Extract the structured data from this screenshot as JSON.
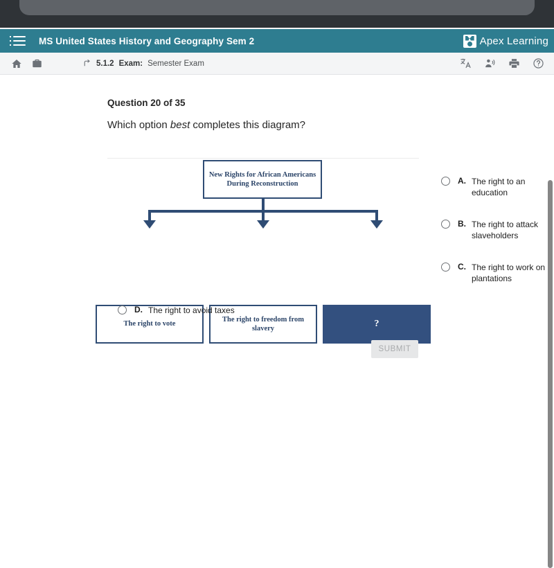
{
  "browser_chrome": {
    "glyph_left": "p",
    "glyph_right": "g"
  },
  "course_header": {
    "menu_icon": "hamburger-menu-icon",
    "title": "MS United States History and Geography Sem 2",
    "brand_name": "Apex Learning",
    "background_color": "#2e7d90"
  },
  "toolbar": {
    "home_icon": "home-icon",
    "briefcase_icon": "briefcase-icon",
    "up_level_icon": "up-level-arrow-icon",
    "breadcrumb_number": "5.1.2",
    "breadcrumb_kind": "Exam:",
    "breadcrumb_name": "Semester Exam",
    "translate_icon": "translate-icon",
    "read_aloud_icon": "read-aloud-icon",
    "print_icon": "print-icon",
    "help_icon": "help-icon"
  },
  "question": {
    "counter": "Question 20 of 35",
    "prompt_before": "Which option ",
    "prompt_emphasis": "best",
    "prompt_after": " completes this diagram?"
  },
  "diagram": {
    "top_box": "New Rights for African Americans During Reconstruction",
    "child_1": "The right to vote",
    "child_2": "The right to freedom from slavery",
    "child_3": "?",
    "line_color": "#2f4c74",
    "highlight_fill": "#33507f"
  },
  "options": [
    {
      "letter": "A.",
      "text": "The right to an education"
    },
    {
      "letter": "B.",
      "text": "The right to attack slaveholders"
    },
    {
      "letter": "C.",
      "text": "The right to work on plantations"
    },
    {
      "letter": "D.",
      "text": "The right to avoid taxes"
    }
  ],
  "submit": {
    "label": "SUBMIT"
  }
}
